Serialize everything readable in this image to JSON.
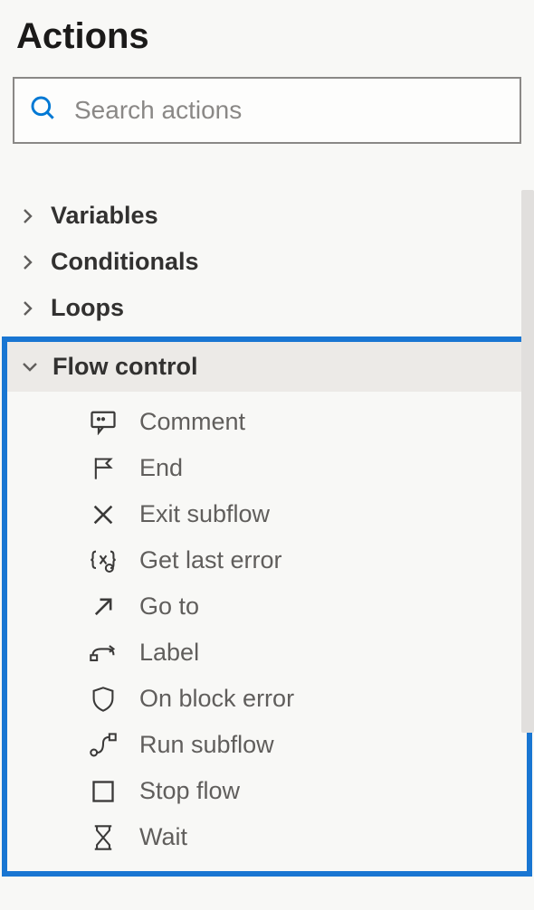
{
  "panel": {
    "title": "Actions"
  },
  "search": {
    "placeholder": "Search actions",
    "value": ""
  },
  "categories": [
    {
      "label": "Variables",
      "expanded": false
    },
    {
      "label": "Conditionals",
      "expanded": false
    },
    {
      "label": "Loops",
      "expanded": false
    }
  ],
  "flow_control": {
    "label": "Flow control",
    "expanded": true,
    "actions": [
      {
        "label": "Comment",
        "icon": "comment-icon"
      },
      {
        "label": "End",
        "icon": "flag-icon"
      },
      {
        "label": "Exit subflow",
        "icon": "x-icon"
      },
      {
        "label": "Get last error",
        "icon": "braces-error-icon"
      },
      {
        "label": "Go to",
        "icon": "arrow-up-right-icon"
      },
      {
        "label": "Label",
        "icon": "label-loop-icon"
      },
      {
        "label": "On block error",
        "icon": "shield-icon"
      },
      {
        "label": "Run subflow",
        "icon": "subflow-icon"
      },
      {
        "label": "Stop flow",
        "icon": "stop-square-icon"
      },
      {
        "label": "Wait",
        "icon": "hourglass-icon"
      }
    ]
  },
  "colors": {
    "highlight": "#1976d2"
  }
}
